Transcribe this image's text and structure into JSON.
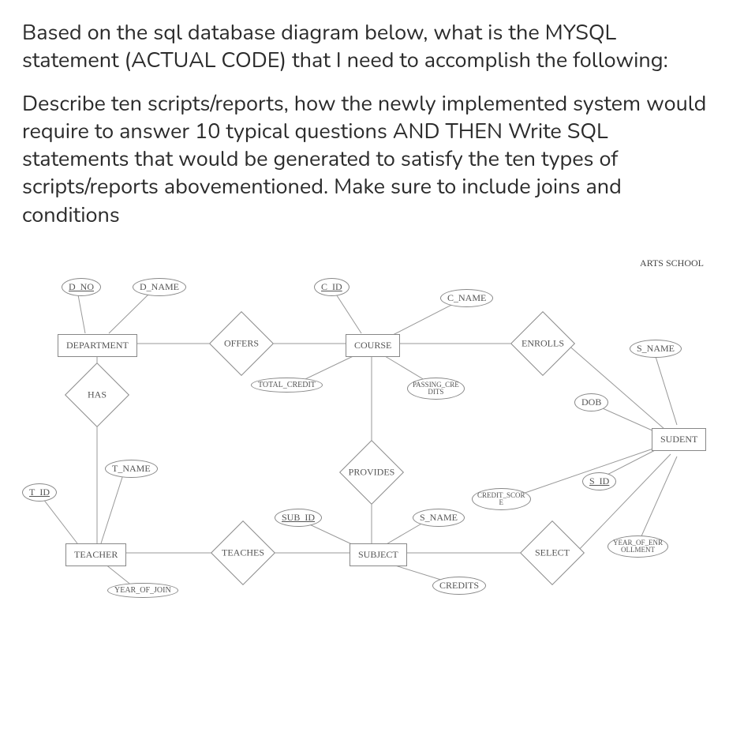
{
  "question": {
    "p1": "Based on the sql database diagram below, what is the MYSQL statement (ACTUAL CODE) that I need to accomplish the following:",
    "p2": "Describe ten scripts/reports, how the newly implemented system would require to answer 10 typical questions AND THEN Write SQL statements that would be generated to satisfy the ten types of scripts/reports abovementioned. Make sure to include joins and conditions"
  },
  "diagram_title": "ARTS SCHOOL",
  "entities": {
    "department": "DEPARTMENT",
    "course": "COURSE",
    "student": "SUDENT",
    "teacher": "TEACHER",
    "subject": "SUBJECT"
  },
  "relationships": {
    "offers": "OFFERS",
    "enrolls": "ENROLLS",
    "has": "HAS",
    "provides": "PROVIDES",
    "teaches": "TEACHES",
    "select": "SELECT"
  },
  "attributes": {
    "d_no": "D_NO",
    "d_name": "D_NAME",
    "c_id": "C_ID",
    "c_name": "C_NAME",
    "total_credit": "TOTAL_CREDIT",
    "passing_credits": "PASSING_CREDITS",
    "s_name_student": "S_NAME",
    "dob": "DOB",
    "s_id": "S_ID",
    "year_of_enrollment": "YEAR_OF_ENROLLMENT",
    "credit_score": "CREDIT_SCORE",
    "t_id": "T_ID",
    "t_name": "T_NAME",
    "year_of_join": "YEAR_OF_JOIN",
    "sub_id": "SUB_ID",
    "s_name_subject": "S_NAME",
    "credits": "CREDITS"
  },
  "chart_data": {
    "type": "er-diagram",
    "title": "ARTS SCHOOL",
    "entities": [
      {
        "name": "DEPARTMENT",
        "attributes": [
          {
            "name": "D_NO",
            "key": true
          },
          {
            "name": "D_NAME"
          }
        ]
      },
      {
        "name": "COURSE",
        "attributes": [
          {
            "name": "C_ID",
            "key": true
          },
          {
            "name": "C_NAME"
          },
          {
            "name": "TOTAL_CREDIT"
          },
          {
            "name": "PASSING_CREDITS"
          }
        ]
      },
      {
        "name": "SUDENT",
        "attributes": [
          {
            "name": "S_ID",
            "key": true
          },
          {
            "name": "S_NAME"
          },
          {
            "name": "DOB"
          },
          {
            "name": "YEAR_OF_ENROLLMENT"
          },
          {
            "name": "CREDIT_SCORE"
          }
        ]
      },
      {
        "name": "TEACHER",
        "attributes": [
          {
            "name": "T_ID",
            "key": true
          },
          {
            "name": "T_NAME"
          },
          {
            "name": "YEAR_OF_JOIN"
          }
        ]
      },
      {
        "name": "SUBJECT",
        "attributes": [
          {
            "name": "SUB_ID",
            "key": true
          },
          {
            "name": "S_NAME"
          },
          {
            "name": "CREDITS"
          }
        ]
      }
    ],
    "relationships": [
      {
        "name": "OFFERS",
        "between": [
          "DEPARTMENT",
          "COURSE"
        ]
      },
      {
        "name": "ENROLLS",
        "between": [
          "COURSE",
          "SUDENT"
        ]
      },
      {
        "name": "HAS",
        "between": [
          "DEPARTMENT",
          "TEACHER"
        ]
      },
      {
        "name": "PROVIDES",
        "between": [
          "COURSE",
          "SUBJECT"
        ]
      },
      {
        "name": "TEACHES",
        "between": [
          "TEACHER",
          "SUBJECT"
        ]
      },
      {
        "name": "SELECT",
        "between": [
          "SUDENT",
          "SUBJECT"
        ]
      }
    ]
  }
}
